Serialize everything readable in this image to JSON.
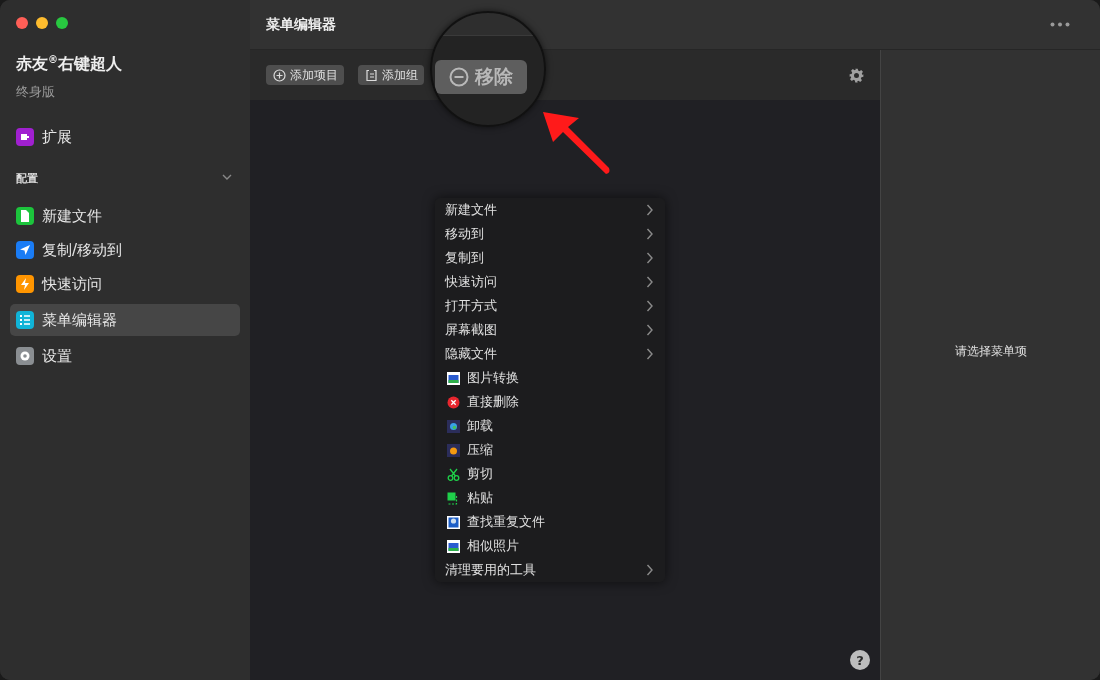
{
  "app": {
    "name": "赤友$^{®}$右键超人",
    "edition": "终身版"
  },
  "sidebar": {
    "items": [
      {
        "label": "扩展",
        "selected": false
      }
    ],
    "section": {
      "title": "配置",
      "expanded": true,
      "items": [
        {
          "label": "新建文件",
          "selected": false
        },
        {
          "label": "复制/移动到",
          "selected": false
        },
        {
          "label": "快速访问",
          "selected": false
        },
        {
          "label": "菜单编辑器",
          "selected": true
        },
        {
          "label": "设置",
          "selected": false
        }
      ]
    }
  },
  "header": {
    "title": "菜单编辑器"
  },
  "toolbar": {
    "buttons": [
      {
        "label": "添加项目"
      },
      {
        "label": "添加组"
      }
    ]
  },
  "magnifier": {
    "button": "移除"
  },
  "menu": {
    "items": [
      {
        "label": "新建文件",
        "kind": "submenu"
      },
      {
        "label": "移动到",
        "kind": "submenu"
      },
      {
        "label": "复制到",
        "kind": "submenu"
      },
      {
        "label": "快速访问",
        "kind": "submenu"
      },
      {
        "label": "打开方式",
        "kind": "submenu"
      },
      {
        "label": "屏幕截图",
        "kind": "submenu"
      },
      {
        "label": "隐藏文件",
        "kind": "submenu"
      },
      {
        "label": "图片转换",
        "kind": "action"
      },
      {
        "label": "直接删除",
        "kind": "action"
      },
      {
        "label": "卸载",
        "kind": "action"
      },
      {
        "label": "压缩",
        "kind": "action"
      },
      {
        "label": "剪切",
        "kind": "action"
      },
      {
        "label": "粘贴",
        "kind": "action"
      },
      {
        "label": "查找重复文件",
        "kind": "action"
      },
      {
        "label": "相似照片",
        "kind": "action"
      },
      {
        "label": "清理要用的工具",
        "kind": "submenu"
      }
    ]
  },
  "detail": {
    "placeholder": "请选择菜单项"
  },
  "help": {
    "label": "?"
  }
}
